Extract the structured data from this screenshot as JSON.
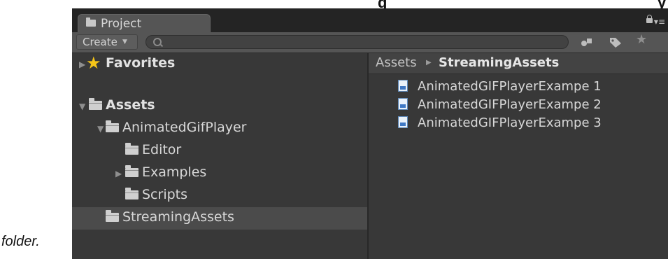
{
  "document": {
    "heading_fragment": "g",
    "heading_fragment_end": "y",
    "caption": "folder."
  },
  "window": {
    "tab": {
      "label": "Project",
      "icon": "folder-icon"
    },
    "header_icons": [
      "lock-icon",
      "window-menu-icon"
    ]
  },
  "toolbar": {
    "create_label": "Create",
    "search": {
      "value": "",
      "placeholder": "",
      "icon": "search-icon"
    },
    "right_icons": [
      "search-by-type-icon",
      "search-by-label-icon",
      "favorites-star-icon"
    ]
  },
  "tree": {
    "favorites": "Favorites",
    "assets": "Assets",
    "animated_gif_player": "AnimatedGifPlayer",
    "editor": "Editor",
    "examples": "Examples",
    "scripts": "Scripts",
    "streaming_assets": "StreamingAssets",
    "selected": "StreamingAssets"
  },
  "content": {
    "breadcrumb": [
      "Assets",
      "StreamingAssets"
    ],
    "files": [
      "AnimatedGIFPlayerExampe 1",
      "AnimatedGIFPlayerExampe 2",
      "AnimatedGIFPlayerExampe 3"
    ]
  },
  "colors": {
    "panel_background": "#383838",
    "toolbar": "#555555",
    "tab_bar": "#242424",
    "selection": "#4b4b4b",
    "favorite_star": "#f5c518"
  }
}
